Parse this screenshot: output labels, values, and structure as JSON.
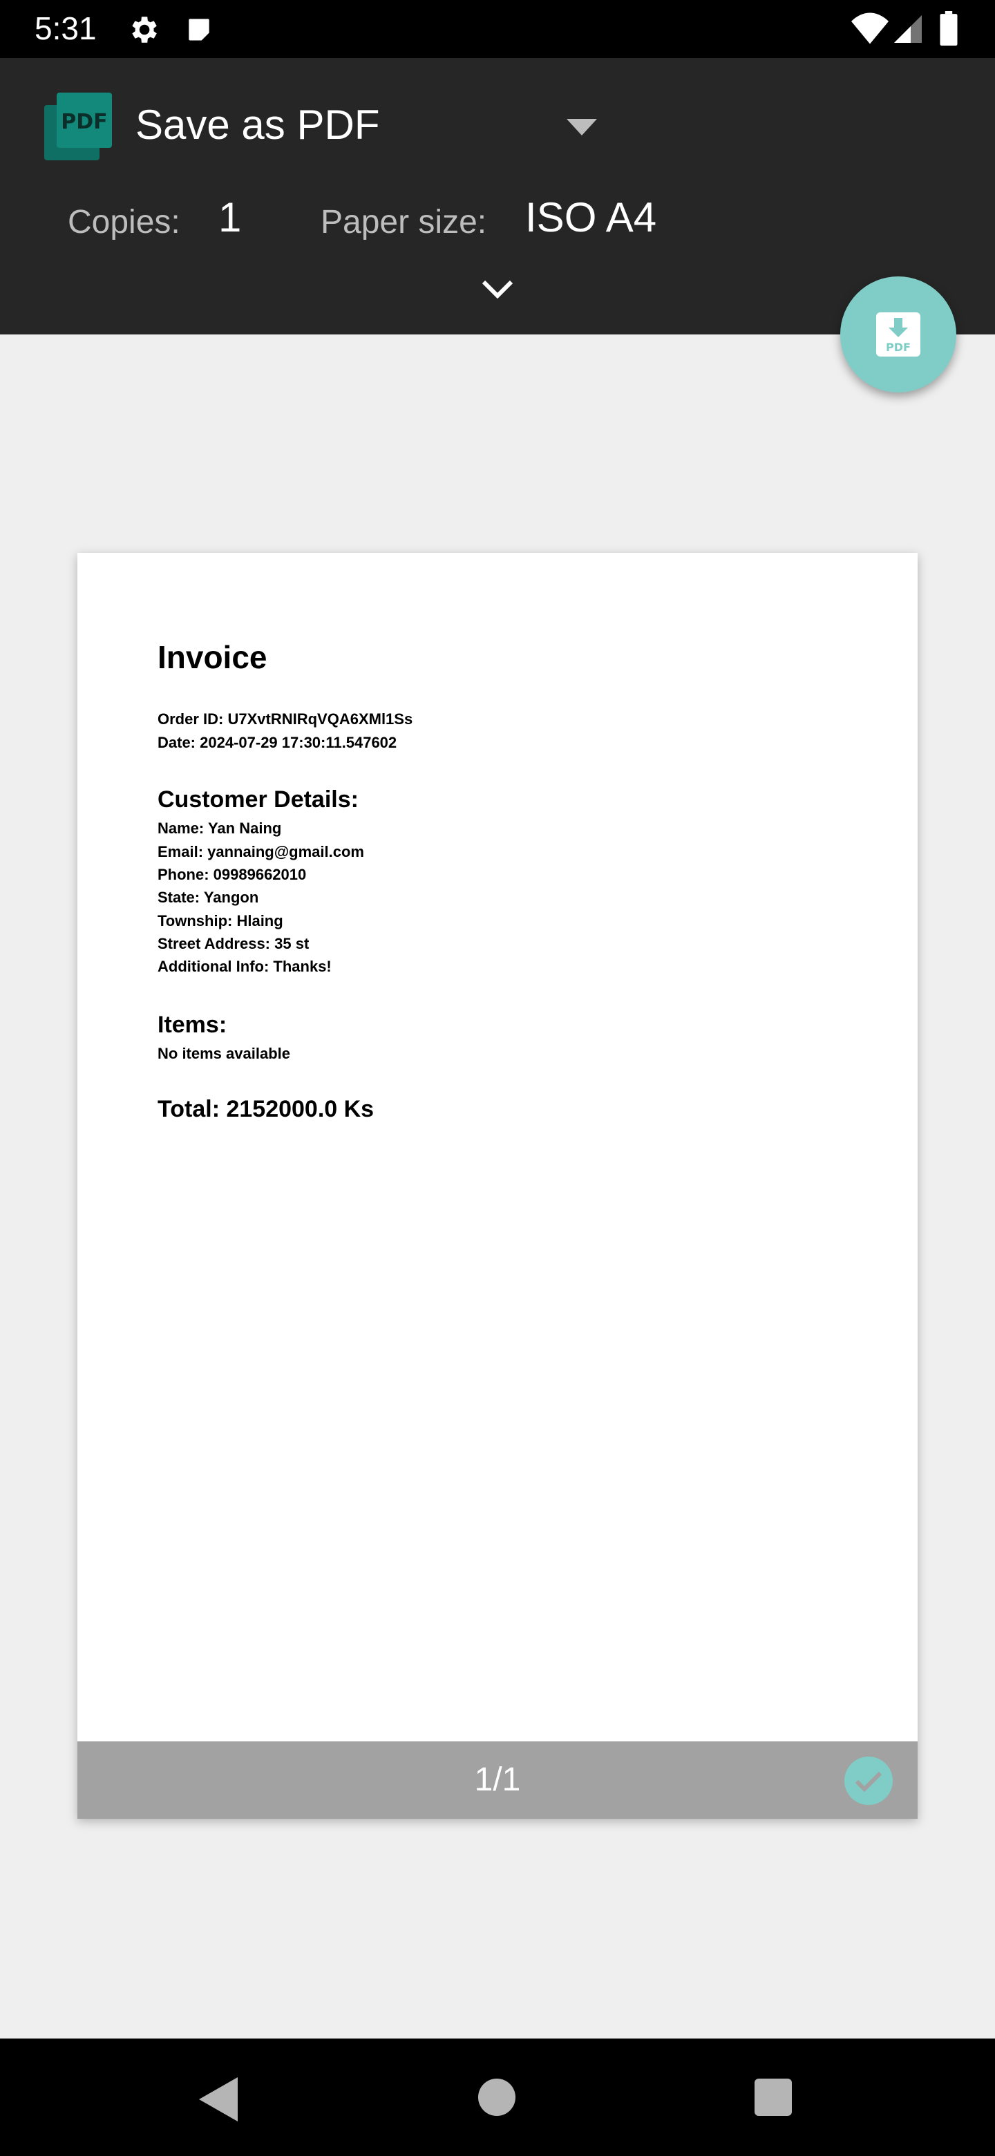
{
  "status_bar": {
    "time": "5:31"
  },
  "print_header": {
    "printer_name": "Save as PDF",
    "pdf_logo_text": "PDF",
    "copies_label": "Copies:",
    "copies_value": "1",
    "paper_size_label": "Paper size:",
    "paper_size_value": "ISO A4"
  },
  "fab": {
    "icon": "pdf-download-icon",
    "icon_text": "PDF"
  },
  "invoice": {
    "title": "Invoice",
    "order_id": "Order ID: U7XvtRNIRqVQA6XMl1Ss",
    "date": "Date: 2024-07-29 17:30:11.547602",
    "customer_heading": "Customer Details:",
    "name": "Name: Yan Naing",
    "email": "Email: yannaing@gmail.com",
    "phone": "Phone: 09989662010",
    "state": "State: Yangon",
    "township": "Township: Hlaing",
    "street": "Street Address: 35 st",
    "additional": "Additional Info: Thanks!",
    "items_heading": "Items:",
    "items_empty": "No items available",
    "total": "Total: 2152000.0 Ks"
  },
  "page_footer": {
    "counter": "1/1"
  },
  "colors": {
    "header_bg": "#262626",
    "accent_teal": "#7fcdc6",
    "logo_teal": "#13897b",
    "page_footer_bg": "#a2a2a2",
    "background": "#efefef"
  }
}
